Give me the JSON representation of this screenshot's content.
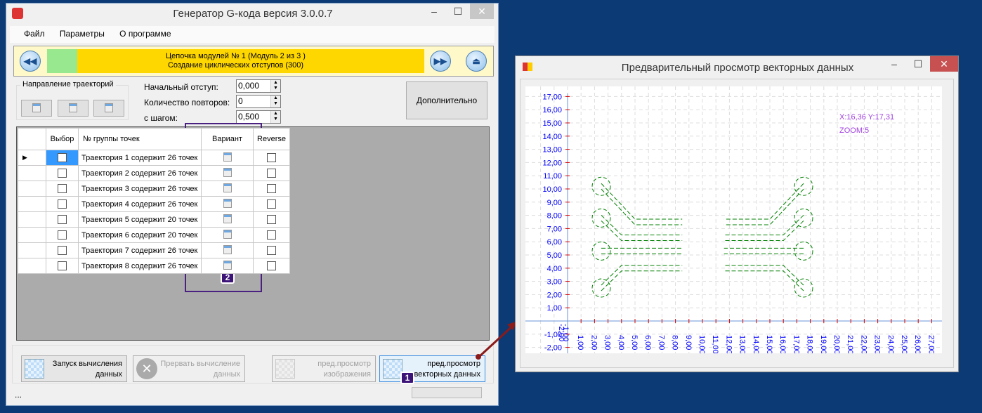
{
  "main_window": {
    "title": "Генератор G-кода версия 3.0.0.7",
    "menu": [
      "Файл",
      "Параметры",
      "О программе"
    ],
    "module_bar": {
      "line1": "Цепочка модулей № 1 (Модуль 2 из 3 )",
      "line2": "Создание циклических отступов (300)",
      "progress_fraction": 0.08,
      "bar_color": "#ffd700",
      "progress_color": "#98e890"
    },
    "direction_group": {
      "label": "Направление траекторий"
    },
    "fields": [
      {
        "label": "Начальный отступ:",
        "value": "0,000"
      },
      {
        "label": "Количество повторов:",
        "value": "0"
      },
      {
        "label": "с шагом:",
        "value": "0,500"
      }
    ],
    "extra_button": "Дополнительно",
    "table": {
      "headers": [
        "Выбор",
        "№ группы точек",
        "Вариант",
        "Reverse"
      ],
      "rows": [
        "Траектория 1 содержит 26 точек",
        "Траектория 2 содержит 26 точек",
        "Траектория 3 содержит 26 точек",
        "Траектория 4 содержит 26 точек",
        "Траектория 5 содержит 20 точек",
        "Траектория 6 содержит 20 точек",
        "Траектория 7 содержит 26 точек",
        "Траектория 8 содержит 26 точек"
      ]
    },
    "buttons": {
      "start": {
        "l1": "Запуск вычисления",
        "l2": "данных"
      },
      "stop": {
        "l1": "Прервать вычисление",
        "l2": "данных"
      },
      "img_preview": {
        "l1": "пред.просмотр",
        "l2": "изображения"
      },
      "vec_preview": {
        "l1": "пред.просмотр",
        "l2": "векторных данных"
      }
    },
    "status": "...",
    "badges": [
      "1",
      "2"
    ]
  },
  "preview_window": {
    "title": "Предварительный просмотр векторных данных",
    "coords": "X:16,36 Y:17,31",
    "zoom": "ZOOM:5"
  },
  "chart_data": {
    "type": "line",
    "xlim": [
      -2,
      27.5
    ],
    "ylim": [
      -2.5,
      17.5
    ],
    "x_ticks": [
      "1,00",
      "2,00",
      "3,00",
      "4,00",
      "5,00",
      "6,00",
      "7,00",
      "8,00",
      "9,00",
      "10,00",
      "11,00",
      "12,00",
      "13,00",
      "14,00",
      "15,00",
      "16,00",
      "17,00",
      "18,00",
      "19,00",
      "20,00",
      "21,00",
      "22,00",
      "23,00",
      "24,00",
      "25,00",
      "26,00",
      "27,00"
    ],
    "x_tick_neg": [
      "-1,00",
      "-2,00"
    ],
    "y_ticks": [
      "17,00",
      "16,00",
      "15,00",
      "14,00",
      "13,00",
      "12,00",
      "11,00",
      "10,00",
      "9,00",
      "8,00",
      "7,00",
      "6,00",
      "5,00",
      "4,00",
      "3,00",
      "2,00",
      "1,00",
      "-1,00",
      "-2,00"
    ],
    "grid": true,
    "series_color": "#008000",
    "pads": [
      [
        2.5,
        10.2
      ],
      [
        2.5,
        7.8
      ],
      [
        2.5,
        5.3
      ],
      [
        2.5,
        2.5
      ],
      [
        17.5,
        10.2
      ],
      [
        17.5,
        7.8
      ],
      [
        17.5,
        5.3
      ],
      [
        17.5,
        2.5
      ]
    ],
    "traces": [
      [
        [
          2.5,
          10.2
        ],
        [
          5,
          7.5
        ],
        [
          8.5,
          7.5
        ]
      ],
      [
        [
          2.5,
          7.8
        ],
        [
          4,
          6.3
        ],
        [
          8.5,
          6.3
        ]
      ],
      [
        [
          2.5,
          5.3
        ],
        [
          8.5,
          5.3
        ]
      ],
      [
        [
          2.5,
          2.5
        ],
        [
          4,
          4
        ],
        [
          8.5,
          4
        ]
      ],
      [
        [
          17.5,
          10.2
        ],
        [
          15,
          7.5
        ],
        [
          11.6,
          7.5
        ]
      ],
      [
        [
          17.5,
          7.8
        ],
        [
          16,
          6.3
        ],
        [
          11.6,
          6.3
        ]
      ],
      [
        [
          17.5,
          5.3
        ],
        [
          11.6,
          5.3
        ]
      ],
      [
        [
          17.5,
          2.5
        ],
        [
          16,
          4
        ],
        [
          11.6,
          4
        ]
      ]
    ]
  }
}
